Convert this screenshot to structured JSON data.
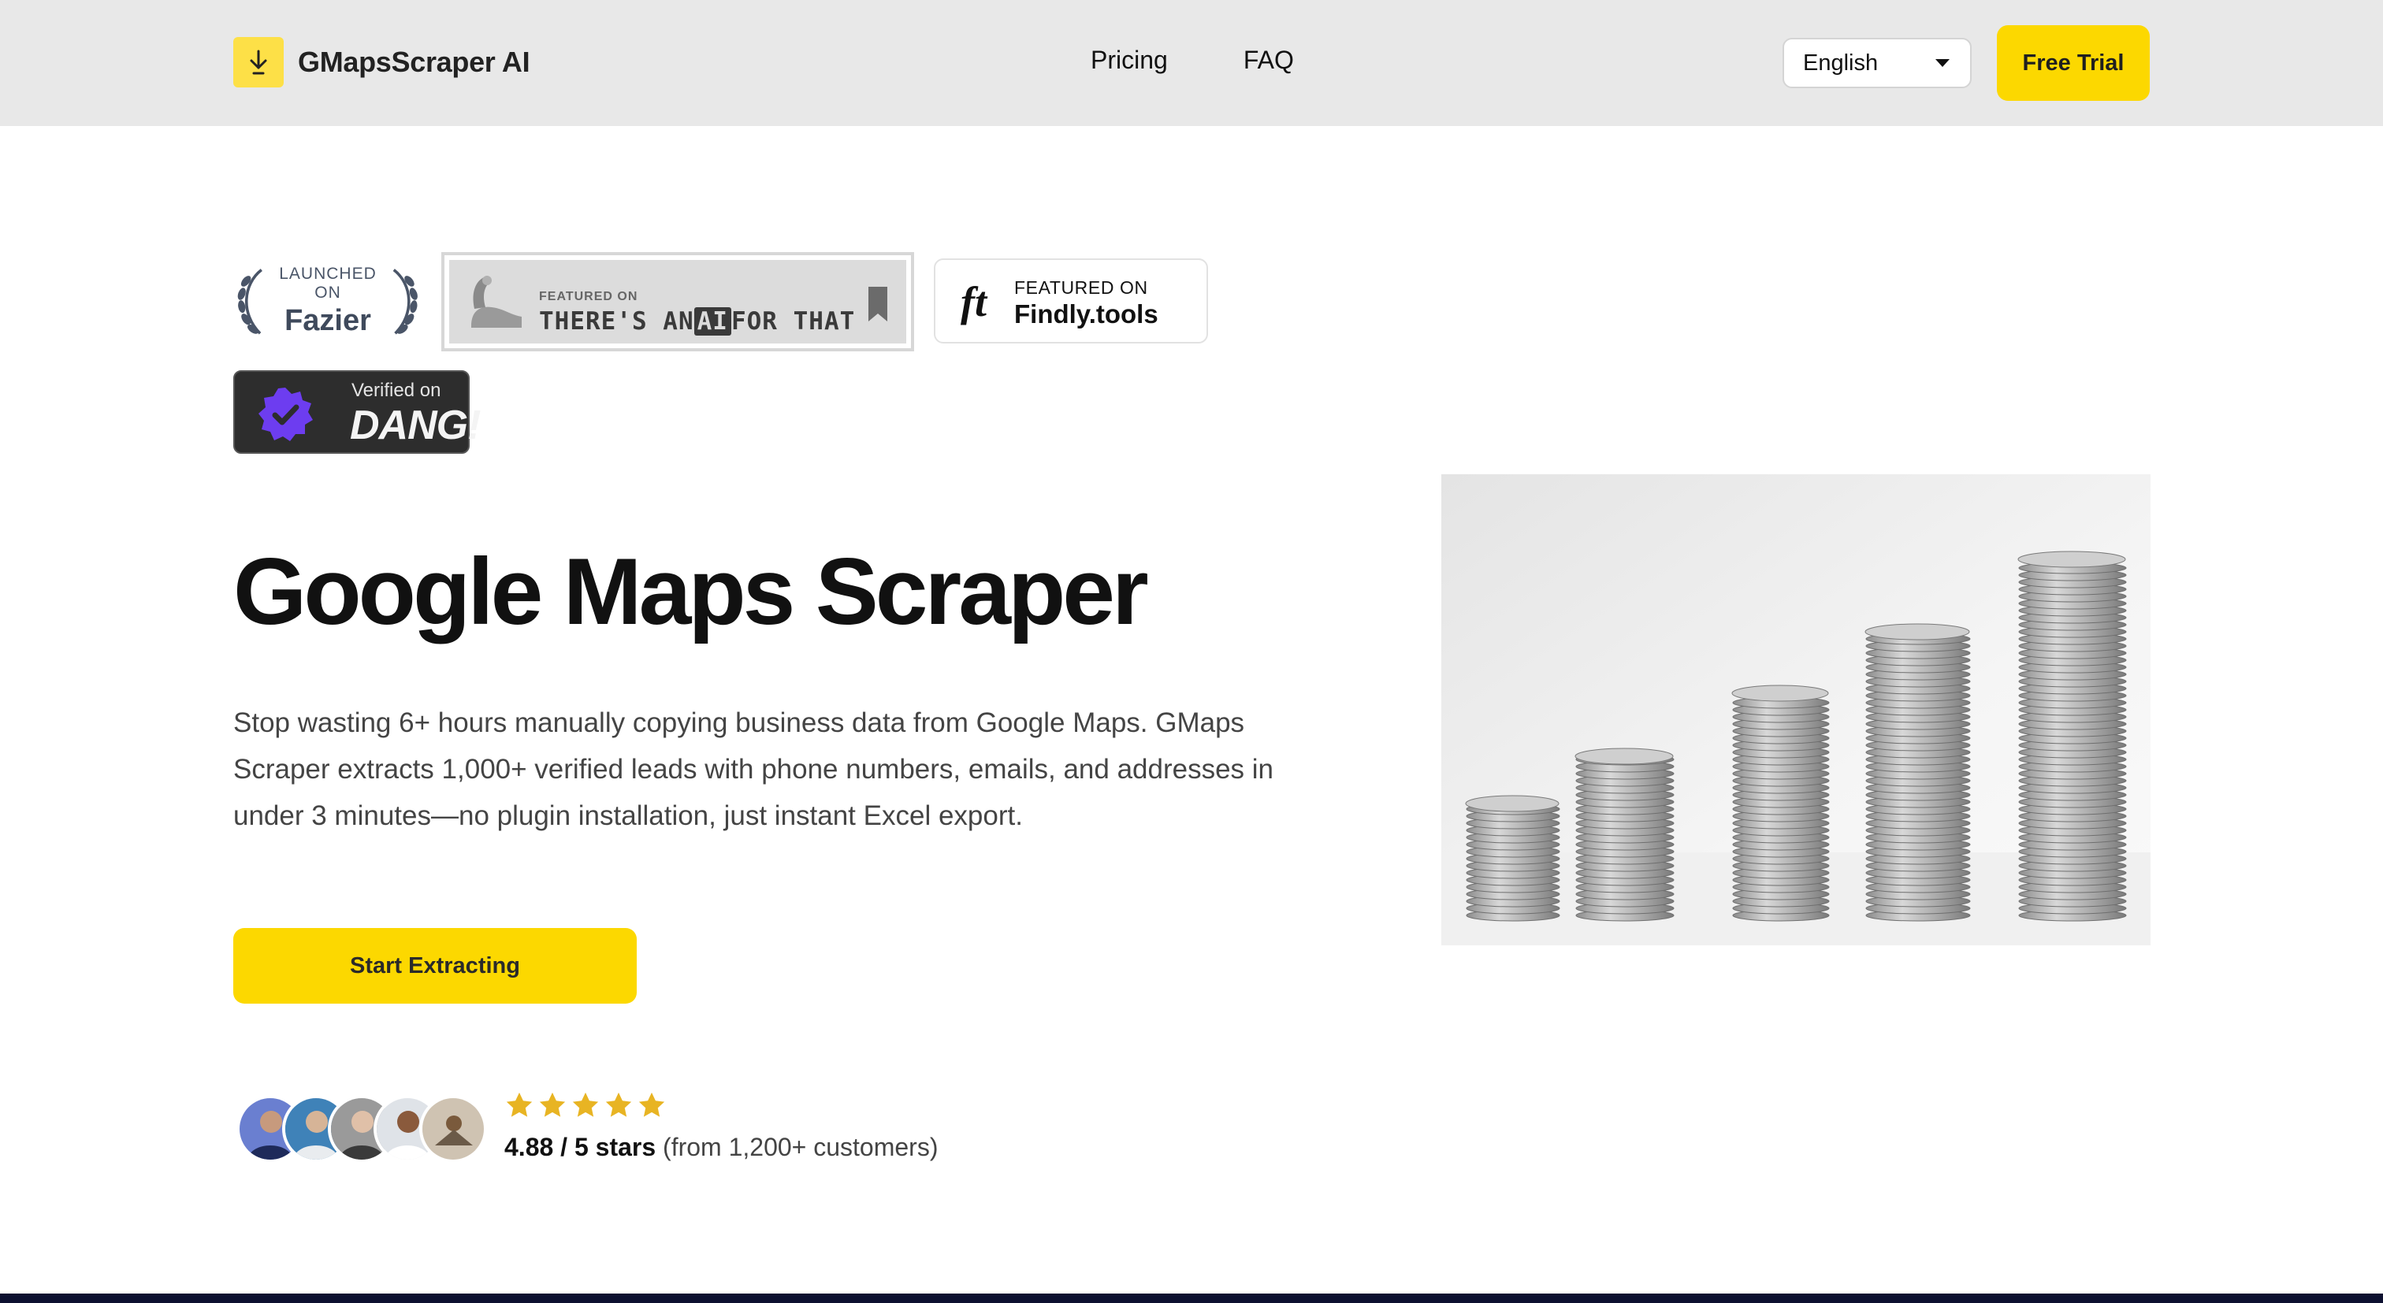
{
  "header": {
    "brand": "GMapsScraper AI",
    "nav": [
      {
        "label": "Pricing"
      },
      {
        "label": "FAQ"
      }
    ],
    "language": "English",
    "trial_label": "Free Trial"
  },
  "badges": {
    "fazier": {
      "small": "LAUNCHED ON",
      "big": "Fazier"
    },
    "aift": {
      "small": "FEATURED ON",
      "pre": "THERE'S AN",
      "ai": "AI",
      "post": "FOR THAT"
    },
    "findly": {
      "logo": "ft",
      "small": "FEATURED ON",
      "big": "Findly.tools"
    },
    "dang": {
      "small": "Verified on",
      "big": "DANG!"
    }
  },
  "hero": {
    "title": "Google Maps Scraper",
    "description": "Stop wasting 6+ hours manually copying business data from Google Maps. GMaps Scraper extracts 1,000+ verified leads with phone numbers, emails, and addresses in under 3 minutes—no plugin installation, just instant Excel export.",
    "cta_label": "Start Extracting"
  },
  "social_proof": {
    "star_count": 5,
    "rating_bold": "4.88 / 5 stars",
    "rating_rest": "(from 1,200+ customers)"
  },
  "colors": {
    "accent": "#fcd800",
    "header_bg": "#e8e8e8",
    "star": "#e8b423",
    "footer_bar": "#0d1030"
  }
}
